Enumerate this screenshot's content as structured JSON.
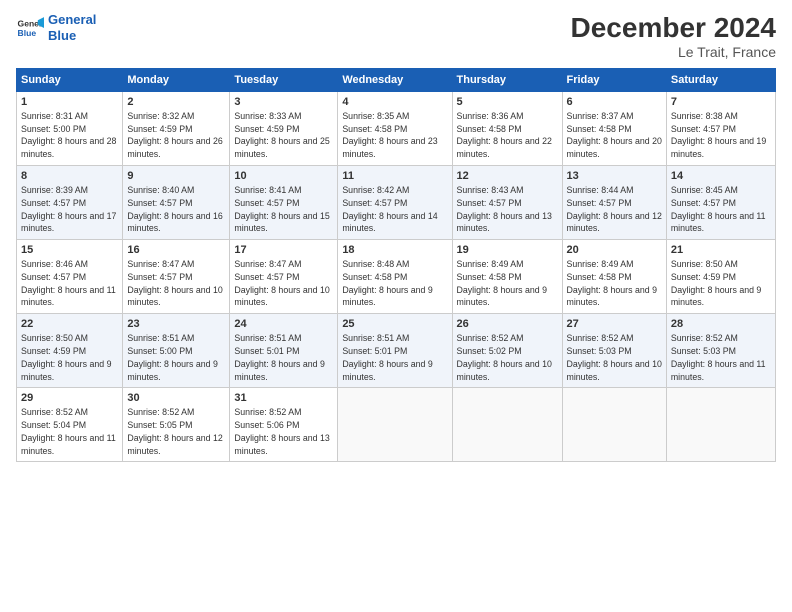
{
  "header": {
    "logo_line1": "General",
    "logo_line2": "Blue",
    "month_title": "December 2024",
    "location": "Le Trait, France"
  },
  "days_of_week": [
    "Sunday",
    "Monday",
    "Tuesday",
    "Wednesday",
    "Thursday",
    "Friday",
    "Saturday"
  ],
  "weeks": [
    [
      {
        "day": "1",
        "sunrise": "Sunrise: 8:31 AM",
        "sunset": "Sunset: 5:00 PM",
        "daylight": "Daylight: 8 hours and 28 minutes."
      },
      {
        "day": "2",
        "sunrise": "Sunrise: 8:32 AM",
        "sunset": "Sunset: 4:59 PM",
        "daylight": "Daylight: 8 hours and 26 minutes."
      },
      {
        "day": "3",
        "sunrise": "Sunrise: 8:33 AM",
        "sunset": "Sunset: 4:59 PM",
        "daylight": "Daylight: 8 hours and 25 minutes."
      },
      {
        "day": "4",
        "sunrise": "Sunrise: 8:35 AM",
        "sunset": "Sunset: 4:58 PM",
        "daylight": "Daylight: 8 hours and 23 minutes."
      },
      {
        "day": "5",
        "sunrise": "Sunrise: 8:36 AM",
        "sunset": "Sunset: 4:58 PM",
        "daylight": "Daylight: 8 hours and 22 minutes."
      },
      {
        "day": "6",
        "sunrise": "Sunrise: 8:37 AM",
        "sunset": "Sunset: 4:58 PM",
        "daylight": "Daylight: 8 hours and 20 minutes."
      },
      {
        "day": "7",
        "sunrise": "Sunrise: 8:38 AM",
        "sunset": "Sunset: 4:57 PM",
        "daylight": "Daylight: 8 hours and 19 minutes."
      }
    ],
    [
      {
        "day": "8",
        "sunrise": "Sunrise: 8:39 AM",
        "sunset": "Sunset: 4:57 PM",
        "daylight": "Daylight: 8 hours and 17 minutes."
      },
      {
        "day": "9",
        "sunrise": "Sunrise: 8:40 AM",
        "sunset": "Sunset: 4:57 PM",
        "daylight": "Daylight: 8 hours and 16 minutes."
      },
      {
        "day": "10",
        "sunrise": "Sunrise: 8:41 AM",
        "sunset": "Sunset: 4:57 PM",
        "daylight": "Daylight: 8 hours and 15 minutes."
      },
      {
        "day": "11",
        "sunrise": "Sunrise: 8:42 AM",
        "sunset": "Sunset: 4:57 PM",
        "daylight": "Daylight: 8 hours and 14 minutes."
      },
      {
        "day": "12",
        "sunrise": "Sunrise: 8:43 AM",
        "sunset": "Sunset: 4:57 PM",
        "daylight": "Daylight: 8 hours and 13 minutes."
      },
      {
        "day": "13",
        "sunrise": "Sunrise: 8:44 AM",
        "sunset": "Sunset: 4:57 PM",
        "daylight": "Daylight: 8 hours and 12 minutes."
      },
      {
        "day": "14",
        "sunrise": "Sunrise: 8:45 AM",
        "sunset": "Sunset: 4:57 PM",
        "daylight": "Daylight: 8 hours and 11 minutes."
      }
    ],
    [
      {
        "day": "15",
        "sunrise": "Sunrise: 8:46 AM",
        "sunset": "Sunset: 4:57 PM",
        "daylight": "Daylight: 8 hours and 11 minutes."
      },
      {
        "day": "16",
        "sunrise": "Sunrise: 8:47 AM",
        "sunset": "Sunset: 4:57 PM",
        "daylight": "Daylight: 8 hours and 10 minutes."
      },
      {
        "day": "17",
        "sunrise": "Sunrise: 8:47 AM",
        "sunset": "Sunset: 4:57 PM",
        "daylight": "Daylight: 8 hours and 10 minutes."
      },
      {
        "day": "18",
        "sunrise": "Sunrise: 8:48 AM",
        "sunset": "Sunset: 4:58 PM",
        "daylight": "Daylight: 8 hours and 9 minutes."
      },
      {
        "day": "19",
        "sunrise": "Sunrise: 8:49 AM",
        "sunset": "Sunset: 4:58 PM",
        "daylight": "Daylight: 8 hours and 9 minutes."
      },
      {
        "day": "20",
        "sunrise": "Sunrise: 8:49 AM",
        "sunset": "Sunset: 4:58 PM",
        "daylight": "Daylight: 8 hours and 9 minutes."
      },
      {
        "day": "21",
        "sunrise": "Sunrise: 8:50 AM",
        "sunset": "Sunset: 4:59 PM",
        "daylight": "Daylight: 8 hours and 9 minutes."
      }
    ],
    [
      {
        "day": "22",
        "sunrise": "Sunrise: 8:50 AM",
        "sunset": "Sunset: 4:59 PM",
        "daylight": "Daylight: 8 hours and 9 minutes."
      },
      {
        "day": "23",
        "sunrise": "Sunrise: 8:51 AM",
        "sunset": "Sunset: 5:00 PM",
        "daylight": "Daylight: 8 hours and 9 minutes."
      },
      {
        "day": "24",
        "sunrise": "Sunrise: 8:51 AM",
        "sunset": "Sunset: 5:01 PM",
        "daylight": "Daylight: 8 hours and 9 minutes."
      },
      {
        "day": "25",
        "sunrise": "Sunrise: 8:51 AM",
        "sunset": "Sunset: 5:01 PM",
        "daylight": "Daylight: 8 hours and 9 minutes."
      },
      {
        "day": "26",
        "sunrise": "Sunrise: 8:52 AM",
        "sunset": "Sunset: 5:02 PM",
        "daylight": "Daylight: 8 hours and 10 minutes."
      },
      {
        "day": "27",
        "sunrise": "Sunrise: 8:52 AM",
        "sunset": "Sunset: 5:03 PM",
        "daylight": "Daylight: 8 hours and 10 minutes."
      },
      {
        "day": "28",
        "sunrise": "Sunrise: 8:52 AM",
        "sunset": "Sunset: 5:03 PM",
        "daylight": "Daylight: 8 hours and 11 minutes."
      }
    ],
    [
      {
        "day": "29",
        "sunrise": "Sunrise: 8:52 AM",
        "sunset": "Sunset: 5:04 PM",
        "daylight": "Daylight: 8 hours and 11 minutes."
      },
      {
        "day": "30",
        "sunrise": "Sunrise: 8:52 AM",
        "sunset": "Sunset: 5:05 PM",
        "daylight": "Daylight: 8 hours and 12 minutes."
      },
      {
        "day": "31",
        "sunrise": "Sunrise: 8:52 AM",
        "sunset": "Sunset: 5:06 PM",
        "daylight": "Daylight: 8 hours and 13 minutes."
      },
      null,
      null,
      null,
      null
    ]
  ]
}
